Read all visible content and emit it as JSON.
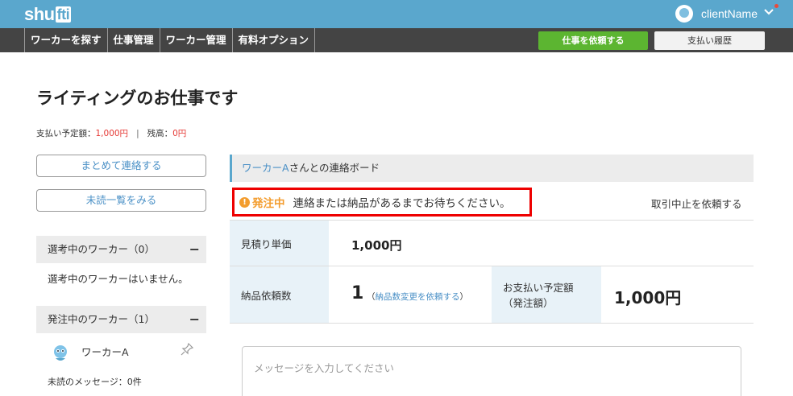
{
  "header": {
    "logo_pre": "shu",
    "logo_box": "fti",
    "username": "clientName"
  },
  "nav": {
    "items": [
      "ワーカーを探す",
      "仕事管理",
      "ワーカー管理",
      "有料オプション"
    ],
    "request_button": "仕事を依頼する",
    "history_button": "支払い履歴"
  },
  "page": {
    "title": "ライティングのお仕事です",
    "balance_label": "支払い予定額：",
    "balance_value": "1,000円",
    "divider": "|",
    "remain_label": "残高：",
    "remain_value": "0円"
  },
  "sidebar": {
    "contact_all": "まとめて連絡する",
    "unread_list": "未読一覧をみる",
    "selecting_head": "選考中のワーカー（0）",
    "selecting_empty": "選考中のワーカーはいません。",
    "ordered_head": "発注中のワーカー（1）",
    "worker_name": "ワーカーA",
    "unread_messages": "未読のメッセージ：0件",
    "collapse_symbol": "−"
  },
  "board": {
    "worker": "ワーカーA",
    "title_suffix": "さんとの連絡ボード",
    "status_label": "発注中",
    "status_message": "連絡または納品があるまでお待ちください。",
    "cancel_link": "取引中止を依頼する",
    "unit_price_label": "見積り単価",
    "unit_price_value": "1,000円",
    "quantity_label": "納品依頼数",
    "quantity_value": "1",
    "quantity_change_link": "納品数変更を依頼する",
    "payment_label_1": "お支払い予定額",
    "payment_label_2": "（発注額）",
    "payment_value": "1,000円",
    "message_placeholder": "メッセージを入力してください"
  },
  "colors": {
    "header_blue": "#5aa7cd",
    "nav_dark": "#444444",
    "green": "#5cb531",
    "status_orange": "#f39c2d",
    "highlight_red": "#e00000",
    "link_blue": "#4a90c6"
  }
}
